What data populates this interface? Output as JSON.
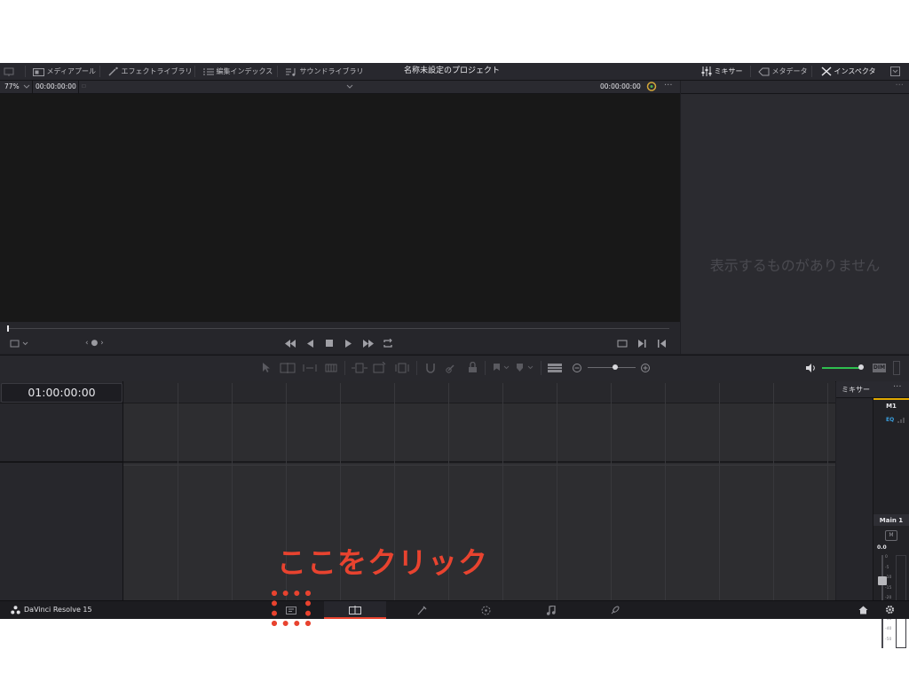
{
  "topbar": {
    "media_pool": "メディアプール",
    "effects_library": "エフェクトライブラリ",
    "edit_index": "編集インデックス",
    "sound_library": "サウンドライブラリ",
    "project_title": "名称未設定のプロジェクト",
    "mixer": "ミキサー",
    "metadata": "メタデータ",
    "inspector": "インスペクタ"
  },
  "viewer": {
    "zoom": "77%",
    "timecode_left": "00:00:00:00",
    "timecode_right": "00:00:00:00"
  },
  "inspector_panel": {
    "empty_message": "表示するものがありません"
  },
  "timeline": {
    "timecode": "01:00:00:00"
  },
  "mixer_panel": {
    "title": "ミキサー",
    "channel_m1": "M1",
    "eq_label": "EQ",
    "main1": "Main 1",
    "m_button": "M",
    "level_value": "0.0",
    "scale": [
      "0",
      "-5",
      "-10",
      "-15",
      "-20",
      "-25",
      "-30",
      "-40",
      "-50"
    ]
  },
  "audio": {
    "dim_label": "DIM"
  },
  "bottombar": {
    "app_name": "DaVinci Resolve 15"
  },
  "annotation": {
    "instruction": "ここをクリック",
    "color": "#e8432f"
  },
  "colors": {
    "accent_underline": "#e8432f",
    "volume_green": "#2fbf4f",
    "mixer_gold": "#e0a800"
  }
}
